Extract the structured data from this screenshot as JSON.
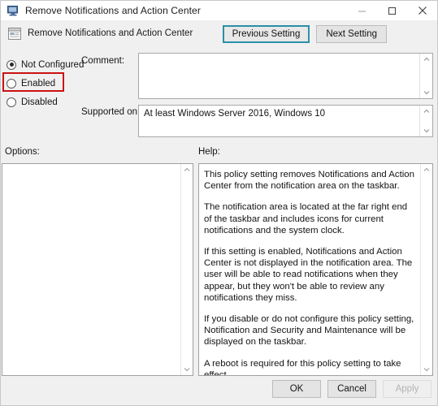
{
  "window": {
    "title": "Remove Notifications and Action Center",
    "icon": "monitor-policy-icon",
    "controls": {
      "minimize": "minimize-icon",
      "maximize": "maximize-icon",
      "close": "close-icon"
    }
  },
  "header": {
    "icon": "policy-setting-icon",
    "title": "Remove Notifications and Action Center",
    "previous_setting_label": "Previous Setting",
    "next_setting_label": "Next Setting"
  },
  "state": {
    "options": [
      {
        "label": "Not Configured",
        "selected": true
      },
      {
        "label": "Enabled",
        "selected": false
      },
      {
        "label": "Disabled",
        "selected": false
      }
    ]
  },
  "fields": {
    "comment_label": "Comment:",
    "comment_value": "",
    "comment_placeholder": "",
    "supported_label": "Supported on:",
    "supported_value": "At least Windows Server 2016, Windows 10"
  },
  "panels": {
    "options_label": "Options:",
    "options_content": "",
    "help_label": "Help:",
    "help_paragraphs": [
      "This policy setting removes Notifications and Action Center from the notification area on the taskbar.",
      "The notification area is located at the far right end of the taskbar and includes icons for current notifications and the system clock.",
      "If this setting is enabled, Notifications and Action Center is not displayed in the notification area. The user will be able to read notifications when they appear, but they won't be able to review any notifications they miss.",
      "If you disable or do not configure this policy setting, Notification and Security and Maintenance will be displayed on the taskbar.",
      "A reboot is required for this policy setting to take effect."
    ]
  },
  "footer": {
    "ok_label": "OK",
    "cancel_label": "Cancel",
    "apply_label": "Apply",
    "apply_disabled": true
  },
  "annotation": {
    "color": "#cc1111",
    "target": "Enabled"
  }
}
